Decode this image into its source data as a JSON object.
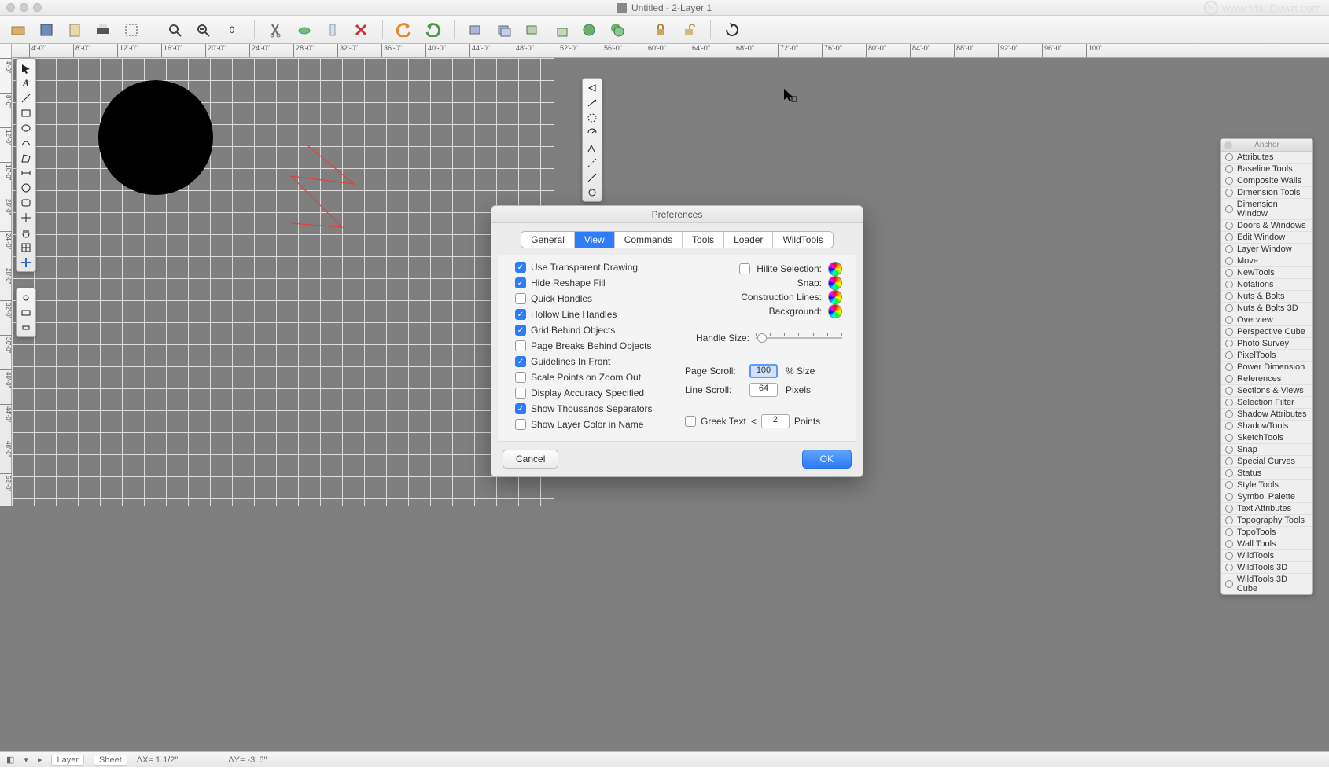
{
  "window": {
    "title": "Untitled - 2-Layer 1",
    "watermark": "www.MacDown.com"
  },
  "ruler": {
    "h_labels": [
      "4'-0\"",
      "8'-0\"",
      "12'-0\"",
      "16'-0\"",
      "20'-0\"",
      "24'-0\"",
      "28'-0\"",
      "32'-0\"",
      "36'-0\"",
      "40'-0\"",
      "44'-0\"",
      "48'-0\"",
      "52'-0\"",
      "56'-0\"",
      "60'-0\"",
      "64'-0\"",
      "68'-0\"",
      "72'-0\"",
      "76'-0\"",
      "80'-0\"",
      "84'-0\"",
      "88'-0\"",
      "92'-0\"",
      "96'-0\"",
      "100'"
    ],
    "v_labels": [
      "4'-0\"",
      "8'-0\"",
      "12'-0\"",
      "16'-0\"",
      "20'-0\"",
      "24'-0\"",
      "28'-0\"",
      "32'-0\"",
      "36'-0\"",
      "40'-0\"",
      "44'-0\"",
      "48'-0\"",
      "52'-0\""
    ]
  },
  "anchor_panel": {
    "title": "Anchor",
    "items": [
      "Attributes",
      "Baseline Tools",
      "Composite Walls",
      "Dimension Tools",
      "Dimension Window",
      "Doors & Windows",
      "Edit Window",
      "Layer Window",
      "Move",
      "NewTools",
      "Notations",
      "Nuts & Bolts",
      "Nuts & Bolts 3D",
      "Overview",
      "Perspective Cube",
      "Photo Survey",
      "PixelTools",
      "Power Dimension",
      "References",
      "Sections & Views",
      "Selection Filter",
      "Shadow Attributes",
      "ShadowTools",
      "SketchTools",
      "Snap",
      "Special Curves",
      "Status",
      "Style Tools",
      "Symbol Palette",
      "Text Attributes",
      "Topography Tools",
      "TopoTools",
      "Wall Tools",
      "WildTools",
      "WildTools 3D",
      "WildTools 3D Cube"
    ]
  },
  "dialog": {
    "title": "Preferences",
    "tabs": [
      "General",
      "View",
      "Commands",
      "Tools",
      "Loader",
      "WildTools"
    ],
    "active_tab": "View",
    "left_checks": [
      {
        "label": "Use Transparent Drawing",
        "checked": true
      },
      {
        "label": "Hide Reshape Fill",
        "checked": true
      },
      {
        "label": "Quick Handles",
        "checked": false
      },
      {
        "label": "Hollow Line Handles",
        "checked": true
      },
      {
        "label": "Grid Behind Objects",
        "checked": true
      },
      {
        "label": "Page Breaks Behind Objects",
        "checked": false
      },
      {
        "label": "Guidelines In Front",
        "checked": true
      },
      {
        "label": "Scale Points on Zoom Out",
        "checked": false
      },
      {
        "label": "Display Accuracy Specified",
        "checked": false
      },
      {
        "label": "Show Thousands Separators",
        "checked": true
      },
      {
        "label": "Show Layer Color in Name",
        "checked": false
      }
    ],
    "right_colors": [
      {
        "label": "Hilite Selection:",
        "has_check": true
      },
      {
        "label": "Snap:",
        "has_check": false
      },
      {
        "label": "Construction Lines:",
        "has_check": false
      },
      {
        "label": "Background:",
        "has_check": false
      }
    ],
    "handle_size_label": "Handle Size:",
    "page_scroll": {
      "label": "Page Scroll:",
      "value": "100",
      "unit": "% Size"
    },
    "line_scroll": {
      "label": "Line Scroll:",
      "value": "64",
      "unit": "Pixels"
    },
    "greek_text": {
      "label": "Greek Text",
      "op": "<",
      "value": "2",
      "unit": "Points"
    },
    "cancel": "Cancel",
    "ok": "OK"
  },
  "status": {
    "layer_btn": "Layer",
    "sheet_btn": "Sheet",
    "dx": "ΔX= 1 1/2\"",
    "dy": "ΔY= -3' 6\""
  },
  "toolbar_zero": "0"
}
